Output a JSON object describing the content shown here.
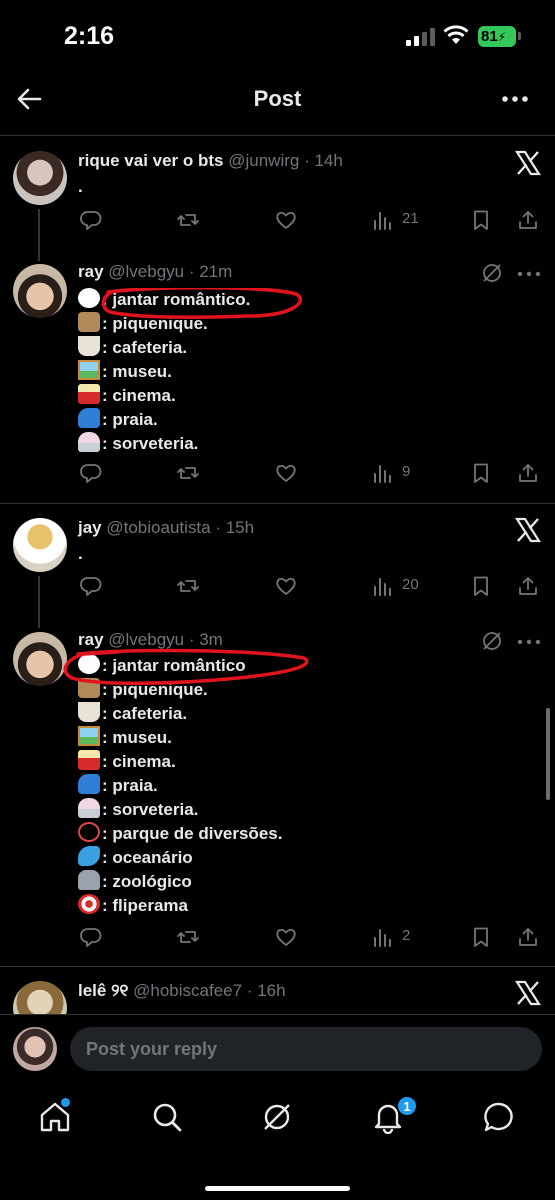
{
  "status_bar": {
    "time": "2:16",
    "battery": "81"
  },
  "header": {
    "title": "Post"
  },
  "tweets": [
    {
      "name": "rique vai ver o bts",
      "handle": "@junwirg · 14h",
      "lines": [
        "."
      ],
      "views": "21"
    },
    {
      "name": "ray",
      "handle": "@lvebgyu · 21m",
      "lines": [
        ": jantar romântico.",
        ": piquenique.",
        ": cafeteria.",
        ": museu.",
        ": cinema.",
        ": praia.",
        ": sorveteria."
      ],
      "views": "9"
    },
    {
      "name": "jay",
      "handle": "@tobioautista · 15h",
      "lines": [
        "."
      ],
      "views": "20"
    },
    {
      "name": "ray",
      "handle": "@lvebgyu · 3m",
      "lines": [
        ": jantar romântico",
        ": piquenique.",
        ": cafeteria.",
        ": museu.",
        ": cinema.",
        ": praia.",
        ": sorveteria.",
        ": parque de diversões.",
        ": oceanário",
        ": zoológico",
        ": fliperama"
      ],
      "views": "2"
    },
    {
      "name": "lelê ୨୧",
      "handle": "@hobiscafee7 · 16h"
    }
  ],
  "reply": {
    "placeholder": "Post your reply"
  },
  "tab_bar": {
    "notifications_badge": "1"
  },
  "colors": {
    "accent": "#1d9bf0",
    "annotation": "#e0141e",
    "battery": "#34c759"
  },
  "icons": [
    "reply-icon",
    "repost-icon",
    "like-icon",
    "views-icon",
    "bookmark-icon",
    "share-icon",
    "x-logo-icon",
    "grok-icon",
    "more-icon",
    "back-arrow-icon",
    "home-icon",
    "search-icon",
    "grok-tab-icon",
    "bell-icon",
    "messages-icon"
  ]
}
